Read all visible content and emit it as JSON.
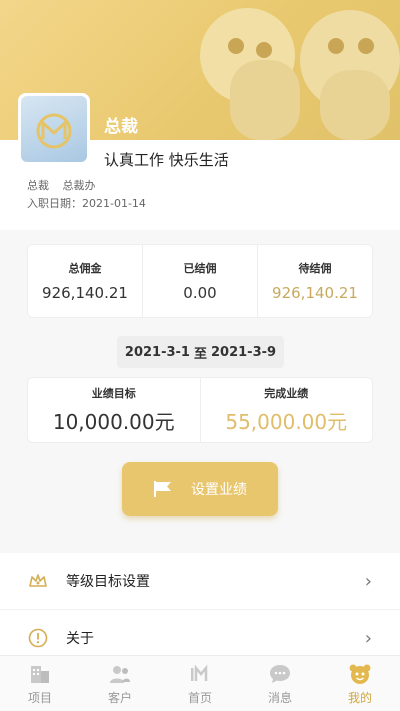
{
  "profile": {
    "name": "总裁",
    "motto": "认真工作 快乐生活",
    "position": "总裁",
    "department": "总裁办",
    "hire_label": "入职日期：",
    "hire_date": "2021-01-14"
  },
  "commission": {
    "total_label": "总佣金",
    "total_value": "926,140.21",
    "settled_label": "已结佣",
    "settled_value": "0.00",
    "pending_label": "待结佣",
    "pending_value": "926,140.21"
  },
  "period": {
    "start": "2021-3-1",
    "separator": "至",
    "end": "2021-3-9"
  },
  "performance": {
    "target_label": "业绩目标",
    "target_value": "10,000.00元",
    "done_label": "完成业绩",
    "done_value": "55,000.00元"
  },
  "actions": {
    "set_performance": "设置业绩"
  },
  "menu": {
    "level_target": "等级目标设置",
    "about": "关于"
  },
  "tabs": [
    {
      "label": "项目",
      "icon": "building-icon"
    },
    {
      "label": "客户",
      "icon": "users-icon"
    },
    {
      "label": "首页",
      "icon": "home-logo-icon"
    },
    {
      "label": "消息",
      "icon": "chat-icon"
    },
    {
      "label": "我的",
      "icon": "mascot-icon",
      "active": true
    }
  ],
  "colors": {
    "accent": "#e8c66e",
    "gold_text": "#c8a95e"
  }
}
